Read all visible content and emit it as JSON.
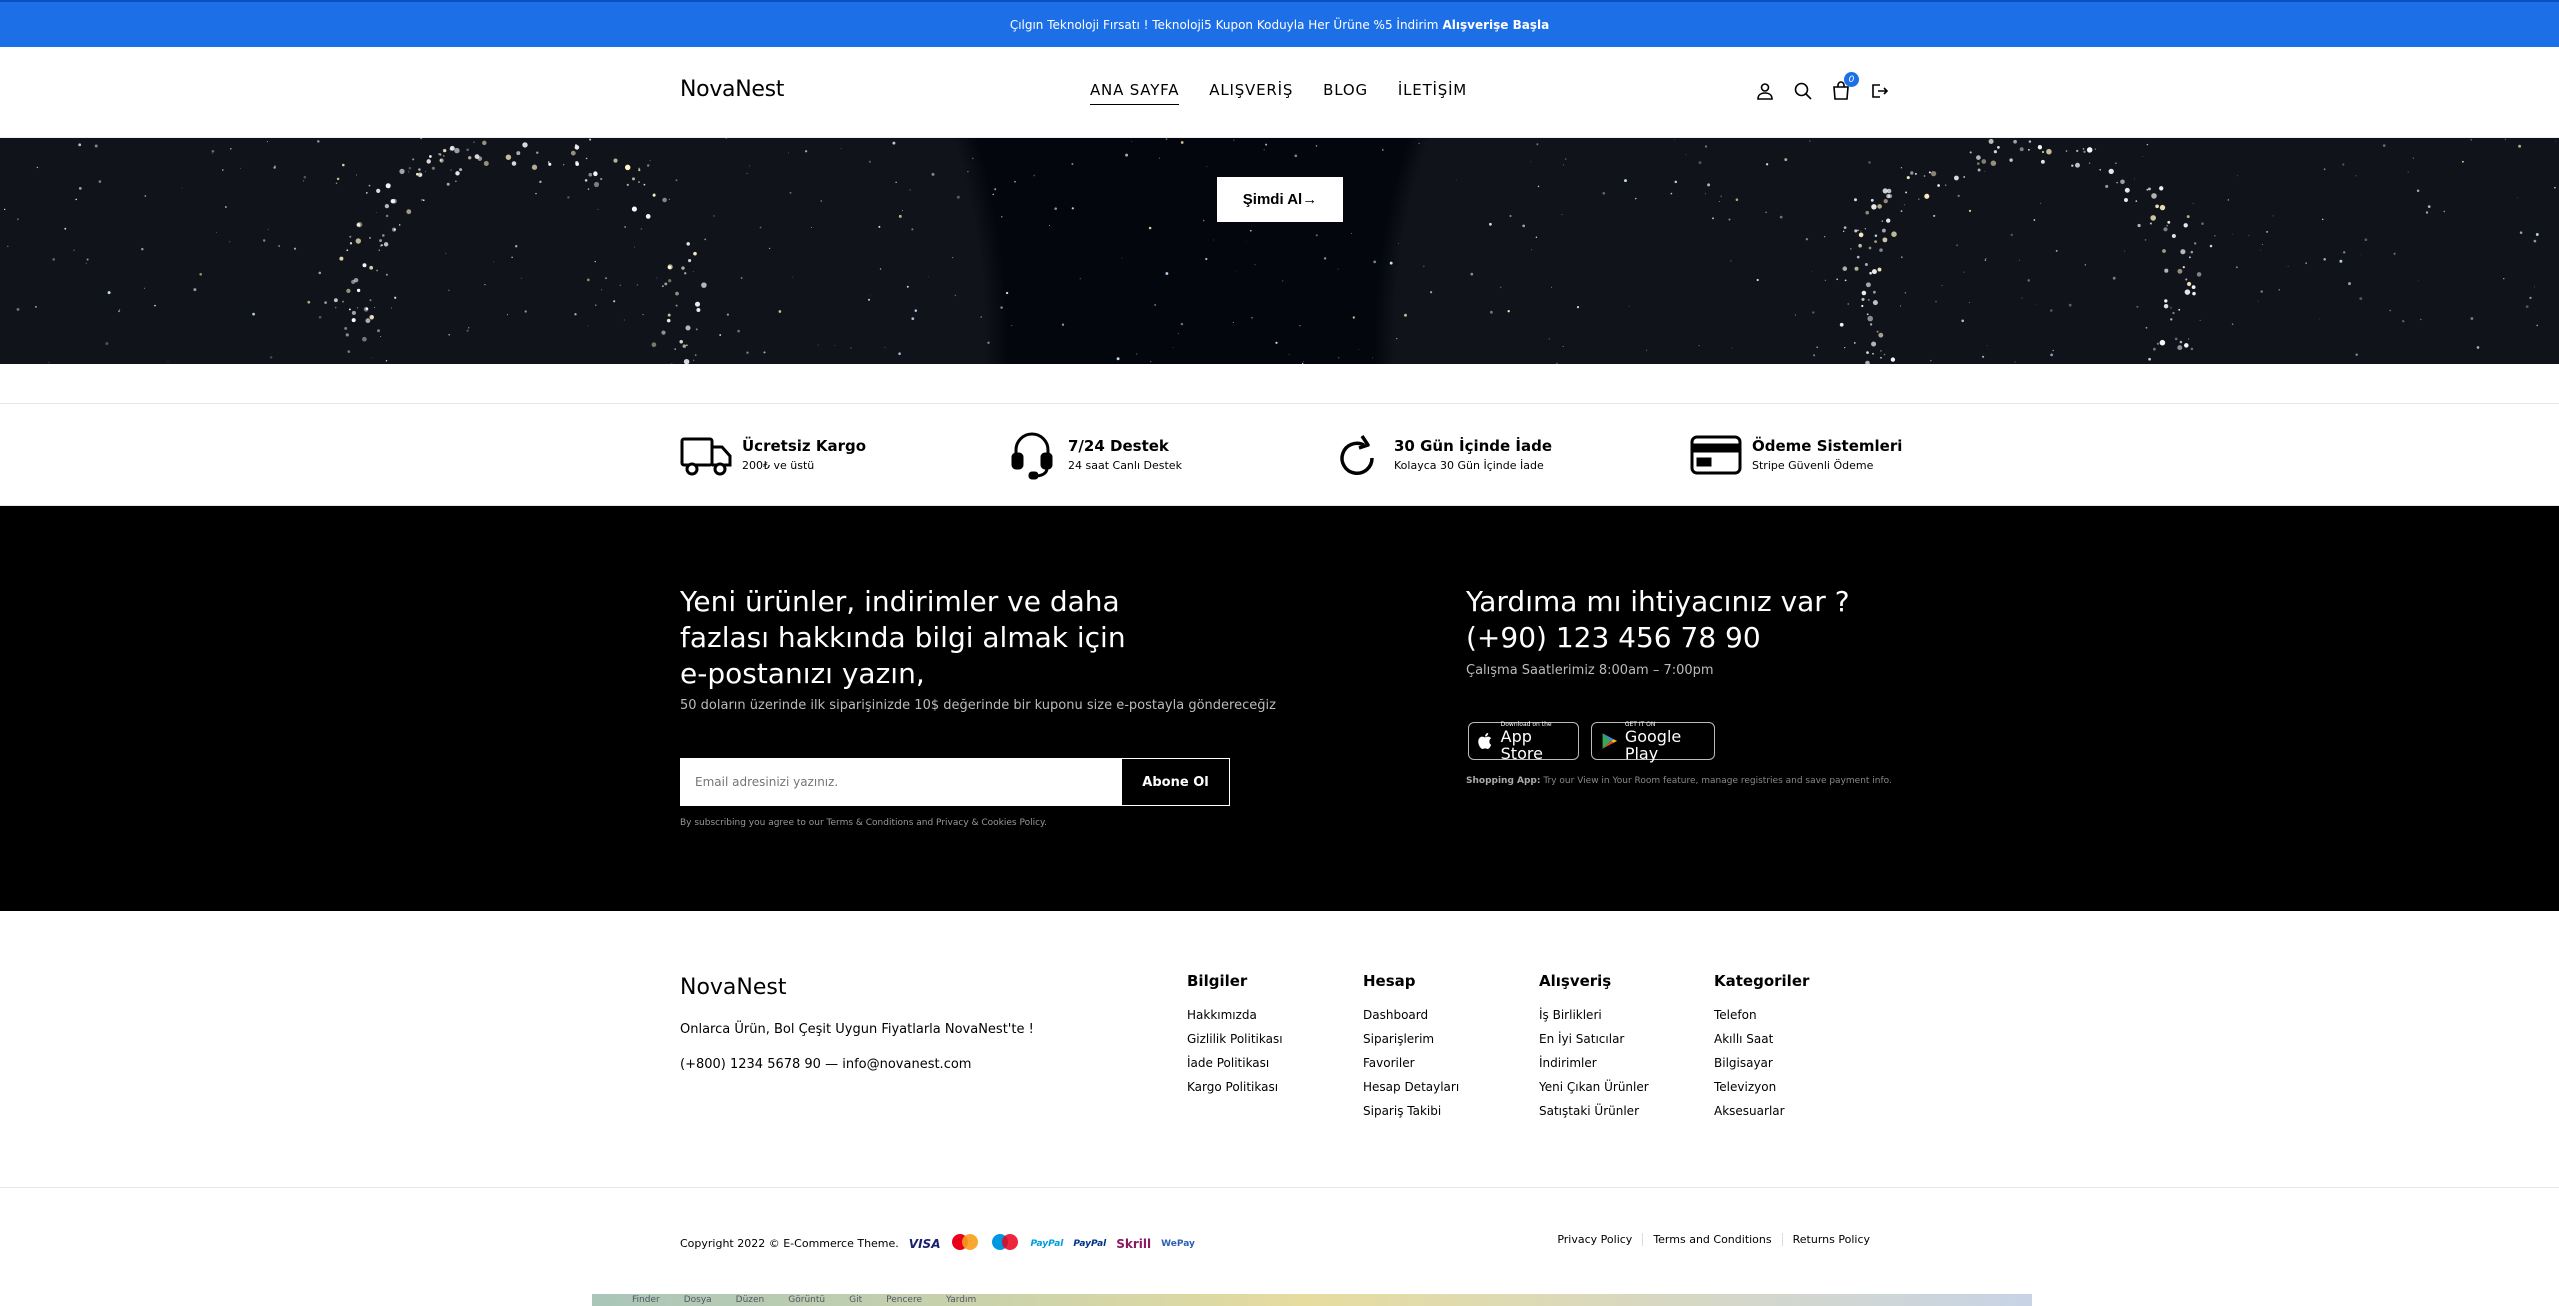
{
  "topbar": {
    "message": "Çılgın Teknoloji Fırsatı ! Teknoloji5 Kupon Koduyla Her Ürüne %5 İndirim",
    "cta": "Alışverişe Başla"
  },
  "header": {
    "logo": "NovaNest",
    "nav": [
      "ANA SAYFA",
      "ALIŞVERİŞ",
      "BLOG",
      "İLETİŞİM"
    ],
    "cart_count": "0",
    "icons": [
      "user-icon",
      "search-icon",
      "cart-icon",
      "logout-icon"
    ]
  },
  "hero": {
    "button": "Şimdi Al→"
  },
  "features": [
    {
      "title": "Ücretsiz Kargo",
      "sub": "200₺ ve üstü",
      "icon": "truck-icon"
    },
    {
      "title": "7/24 Destek",
      "sub": "24 saat Canlı Destek",
      "icon": "headset-icon"
    },
    {
      "title": "30 Gün İçinde İade",
      "sub": "Kolayca 30 Gün İçinde İade",
      "icon": "refresh-icon"
    },
    {
      "title": "Ödeme Sistemleri",
      "sub": "Stripe Güvenli Ödeme",
      "icon": "credit-card-icon"
    }
  ],
  "newsletter": {
    "title": "Yeni ürünler, indirimler ve daha fazlası hakkında bilgi almak için e-postanızı yazın,",
    "subtitle": "50 doların üzerinde ilk siparişinizde 10$ değerinde bir kuponu size e-postayla göndereceğiz",
    "placeholder": "Email adresinizi yazınız.",
    "button": "Abone Ol",
    "note": "By subscribing you agree to our Terms & Conditions and Privacy & Cookies Policy."
  },
  "help": {
    "title": "Yardıma mı ihtiyacınız var ?",
    "phone": "(+90) 123 456 78 90",
    "hours": "Çalışma Saatlerimiz 8:00am – 7:00pm",
    "appstore_small": "Download on the",
    "appstore_big": "App Store",
    "googleplay_small": "GET IT ON",
    "googleplay_big": "Google Play",
    "shopapp_label": "Shopping App:",
    "shopapp_text": "Try our View in Your Room feature, manage registries and save payment info."
  },
  "footer": {
    "logo": "NovaNest",
    "desc": "Onlarca Ürün, Bol Çeşit Uygun Fiyatlarla NovaNest'te !",
    "contact": "(+800) 1234 5678 90 — info@novanest.com",
    "columns": [
      {
        "title": "Bilgiler",
        "links": [
          "Hakkımızda",
          "Gizlilik Politikası",
          "İade Politikası",
          "Kargo Politikası"
        ]
      },
      {
        "title": "Hesap",
        "links": [
          "Dashboard",
          "Siparişlerim",
          "Favoriler",
          "Hesap Detayları",
          "Sipariş Takibi"
        ]
      },
      {
        "title": "Alışveriş",
        "links": [
          "İş Birlikleri",
          "En İyi Satıcılar",
          "İndirimler",
          "Yeni Çıkan Ürünler",
          "Satıştaki Ürünler"
        ]
      },
      {
        "title": "Kategoriler",
        "links": [
          "Telefon",
          "Akıllı Saat",
          "Bilgisayar",
          "Televizyon",
          "Aksesuarlar"
        ]
      }
    ],
    "copyright": "Copyright 2022 © E-Commerce Theme.",
    "payments": [
      "VISA",
      "MasterCard",
      "Maestro",
      "PayPal",
      "PayPal",
      "Skrill",
      "WePay"
    ],
    "legal": [
      "Privacy Policy",
      "Terms and Conditions",
      "Returns Policy"
    ]
  },
  "taskbar": {
    "items": [
      "Finder",
      "Dosya",
      "Düzen",
      "Görüntü",
      "Git",
      "Pencere",
      "Yardım"
    ]
  },
  "colors": {
    "accent": "#1c6fe6",
    "dark": "#000000"
  }
}
